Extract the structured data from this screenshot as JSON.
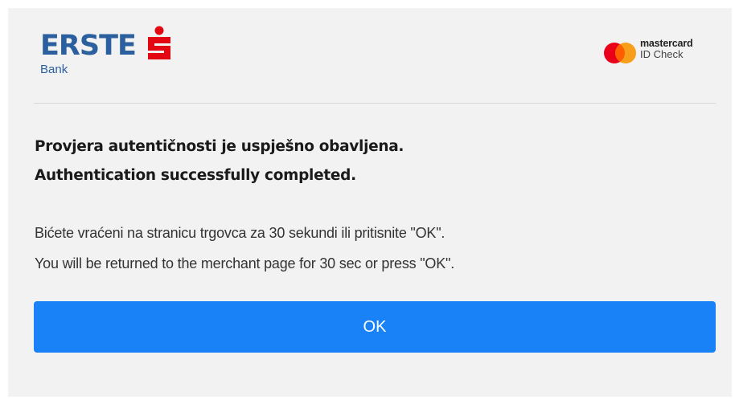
{
  "header": {
    "bank_logo": {
      "wordmark": "ERSTE",
      "subtitle": "Bank",
      "brand_color": "#2b5f9e",
      "symbol_color": "#e30613",
      "symbol_icon": "erste-s-icon"
    },
    "network_logo": {
      "name": "mastercard",
      "sub": "ID Check",
      "circle_colors": [
        "#eb001b",
        "#f79e1b",
        "#ff5f00"
      ]
    }
  },
  "content": {
    "title_hr": "Provjera autentičnosti je uspješno obavljena.",
    "title_en": "Authentication successfully completed.",
    "message_hr": "Bićete vraćeni na stranicu trgovca za 30 sekundi ili pritisnite \"OK\".",
    "message_en": "You will be returned to the merchant page for 30 sec or press \"OK\"."
  },
  "actions": {
    "ok_label": "OK",
    "ok_color": "#1a82f7"
  }
}
